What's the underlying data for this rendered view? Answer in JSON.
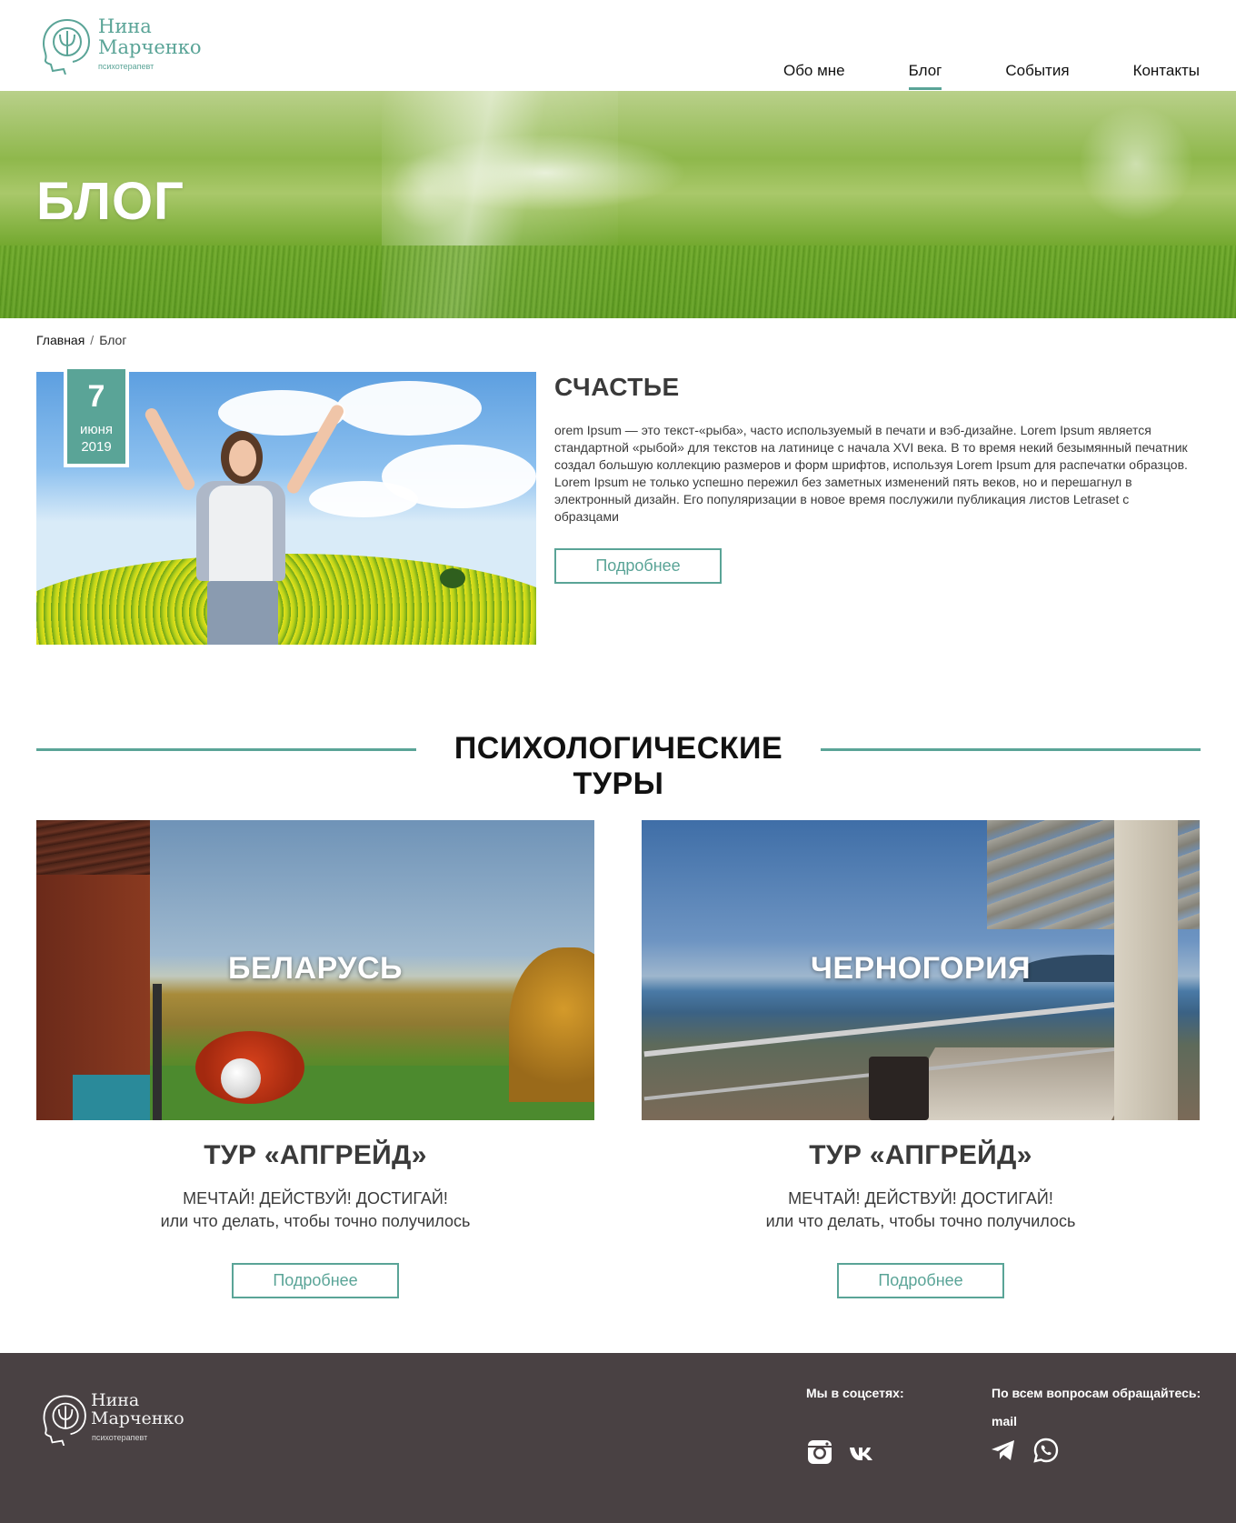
{
  "header": {
    "logo": {
      "name_line1": "Нина",
      "name_line2": "Марченко",
      "subtitle": "психотерапевт"
    },
    "nav": [
      {
        "label": "Обо мне",
        "active": false
      },
      {
        "label": "Блог",
        "active": true
      },
      {
        "label": "События",
        "active": false
      },
      {
        "label": "Контакты",
        "active": false
      }
    ]
  },
  "hero": {
    "title": "БЛОГ"
  },
  "breadcrumb": {
    "home": "Главная",
    "separator": "/",
    "current": "Блог"
  },
  "featured_post": {
    "date": {
      "day": "7",
      "month": "июня",
      "year": "2019"
    },
    "title": "СЧАСТЬЕ",
    "text": "orem Ipsum — это текст-«рыба», часто используемый в печати и вэб-дизайне. Lorem Ipsum является стандартной «рыбой» для текстов на латинице с начала XVI века. В то время некий безымянный печатник создал большую коллекцию размеров и форм шрифтов, используя Lorem Ipsum для распечатки образцов. Lorem Ipsum не только успешно пережил без заметных изменений пять веков, но и перешагнул в электронный дизайн. Его популяризации в новое время послужили публикация листов Letraset с образцами",
    "button": "Подробнее"
  },
  "tours_section": {
    "title": "ПСИХОЛОГИЧЕСКИЕ ТУРЫ",
    "tours": [
      {
        "country": "БЕЛАРУСЬ",
        "name": "ТУР «АПГРЕЙД»",
        "tagline": "МЕЧТАЙ! ДЕЙСТВУЙ! ДОСТИГАЙ!",
        "subtitle": "или что делать, чтобы точно получилось",
        "button": "Подробнее"
      },
      {
        "country": "ЧЕРНОГОРИЯ",
        "name": "ТУР «АПГРЕЙД»",
        "tagline": "МЕЧТАЙ! ДЕЙСТВУЙ! ДОСТИГАЙ!",
        "subtitle": "или что делать, чтобы точно получилось",
        "button": "Подробнее"
      }
    ]
  },
  "footer": {
    "logo": {
      "name_line1": "Нина",
      "name_line2": "Марченко",
      "subtitle": "психотерапевт"
    },
    "social_label": "Мы в соцсетях:",
    "social_icons": [
      "instagram-icon",
      "vk-icon"
    ],
    "contact_label": "По всем вопросам обращайтесь:",
    "mail": "mail",
    "contact_icons": [
      "telegram-icon",
      "whatsapp-icon"
    ]
  },
  "colors": {
    "accent": "#5aa497",
    "footer_bg": "#494143",
    "text": "#3a3a3a"
  }
}
